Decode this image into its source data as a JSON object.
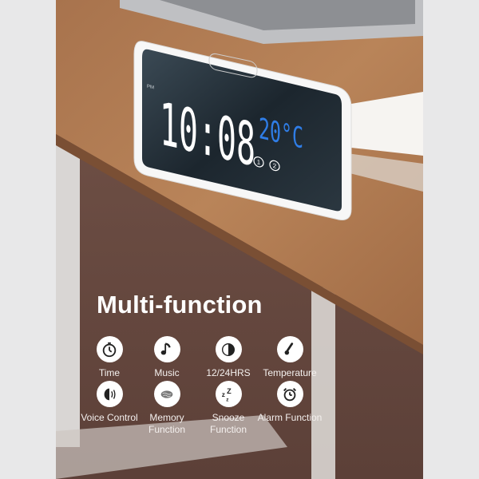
{
  "clock": {
    "time": "10:08",
    "am_pm": "PM",
    "temperature": "20°C",
    "alarm_indicators": [
      "1",
      "2"
    ],
    "colors": {
      "time": "#ffffff",
      "temperature": "#2f7de6",
      "screen": "#1f2a33",
      "body": "#f7f7f7"
    }
  },
  "headline": "Multi-function",
  "features": [
    {
      "icon": "stopwatch-icon",
      "label": "Time"
    },
    {
      "icon": "music-note-icon",
      "label": "Music"
    },
    {
      "icon": "clock-half-icon",
      "label": "12/24HRS"
    },
    {
      "icon": "thermometer-icon",
      "label": "Temperature"
    },
    {
      "icon": "voice-head-icon",
      "label": "Voice Control"
    },
    {
      "icon": "brain-icon",
      "label": "Memory Function"
    },
    {
      "icon": "zzz-icon",
      "label": "Snooze Function"
    },
    {
      "icon": "alarm-clock-icon",
      "label": "Alarm Function"
    }
  ]
}
